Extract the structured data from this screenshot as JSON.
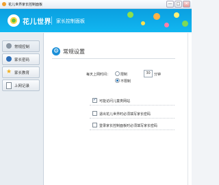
{
  "window": {
    "title": "花儿世界家长控制面板",
    "minimize_glyph": "—",
    "maximize_glyph": "□",
    "close_glyph": "✕"
  },
  "banner": {
    "brand": "花儿世界",
    "subtitle": "家长控制面板"
  },
  "sidebar": {
    "items": [
      {
        "label": "常规控制",
        "icon": "gear-icon",
        "active": true
      },
      {
        "label": "家长密码",
        "icon": "key-icon",
        "active": false
      },
      {
        "label": "家长教育",
        "icon": "star-icon",
        "active": false
      },
      {
        "label": "上网记录",
        "icon": "document-icon",
        "active": false
      }
    ]
  },
  "main": {
    "section_title": "常规设置",
    "time_limit": {
      "label": "每天上网时间：",
      "option_limit": "限制",
      "value": "30",
      "unit": "分钟",
      "option_unlimited": "不限制",
      "selected": "unlimited"
    },
    "checkboxes": [
      {
        "label": "可能访问儿童类网站",
        "checked": true
      },
      {
        "label": "退出花儿世界时必须填写家长密码",
        "checked": false
      },
      {
        "label": "登录家长控制面板时必须填写家长密码",
        "checked": false
      }
    ]
  },
  "colors": {
    "banner": "#0fa8e8",
    "accent": "#1a8fd8"
  }
}
